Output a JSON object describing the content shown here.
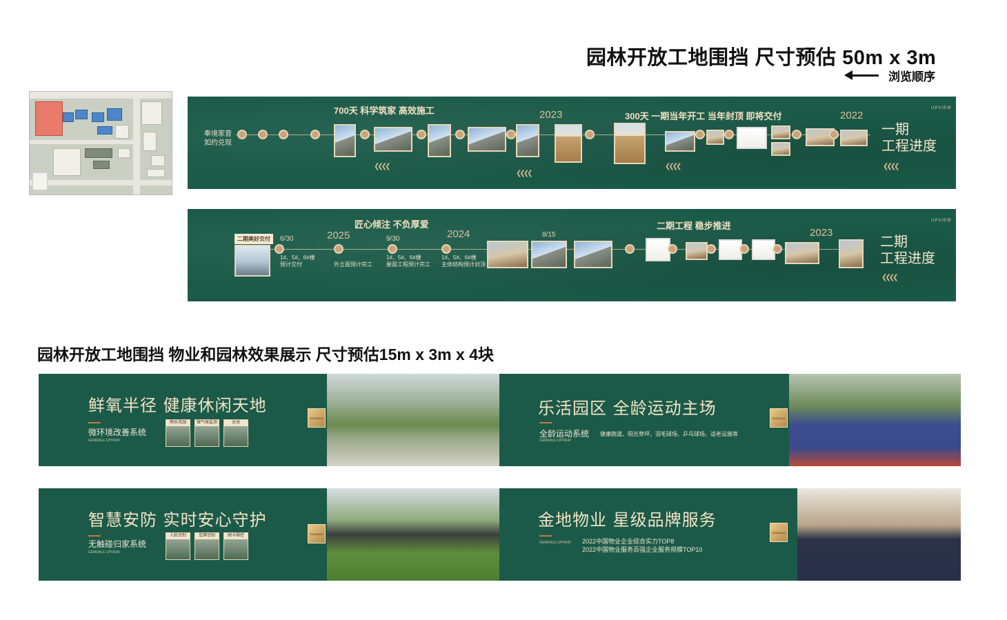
{
  "header": {
    "title": "园林开放工地围挡 尺寸预估 50m x 3m",
    "browse_label": "浏览顺序"
  },
  "banner1": {
    "left_text": [
      "奉境家音",
      "如约兑现"
    ],
    "head_a": "700天  科学筑家  高效施工",
    "head_b": "300天 一期当年开工  当年封顶  即将交付",
    "year_a": "2023",
    "year_b": "2022",
    "side_title": [
      "一期",
      "工程进度"
    ],
    "brand": "UPVIEW"
  },
  "banner2": {
    "tag": "二期美好交付",
    "date_a": "6/30",
    "text_a": [
      "1#、5#、6#楼",
      "预计交付"
    ],
    "year_a": "2025",
    "text_b": "外立面预计完工",
    "date_b": "9/30",
    "text_c": [
      "1#、5#、6#楼",
      "屋面工程预计完工"
    ],
    "year_b": "2024",
    "text_d": [
      "1#、5#、6#楼",
      "主体结构预计封顶"
    ],
    "head_a": "匠心倾注  不负厚爱",
    "date_c": "8/15",
    "head_b": "二期工程  稳步推进",
    "year_c": "2023",
    "side_title": [
      "二期",
      "工程进度"
    ]
  },
  "subtitle": "园林开放工地围挡  物业和园林效果展示 尺寸预估15m x 3m x 4块",
  "panel1": {
    "headline": "鲜氧半径 健康休闲天地",
    "subline": "微环境改善系统",
    "en": "GEMDALE UPVIEW",
    "thumbs": [
      "雨水花园",
      "微气候监测",
      "泳池"
    ]
  },
  "panel2": {
    "headline": "乐活园区   全龄运动主场",
    "subline": "全龄运动系统",
    "en": "GEMDALE UPVIEW",
    "desc": "健康跑道、阳光草坪、羽毛球场、乒乓球场、适老设施等"
  },
  "panel3": {
    "headline": "智慧安防   实时安心守护",
    "subline": "无触碰归家系统",
    "en": "GEMDALE UPVIEW",
    "thumbs": [
      "人脸识别",
      "车牌识别",
      "刷卡梯控"
    ]
  },
  "panel4": {
    "headline": "金地物业   星级品牌服务",
    "en": "GEMDALE UPVIEW",
    "lines": [
      "2022中国物业企业综合实力TOP8",
      "2022中国物业服务百强企业服务规模TOP10"
    ]
  }
}
